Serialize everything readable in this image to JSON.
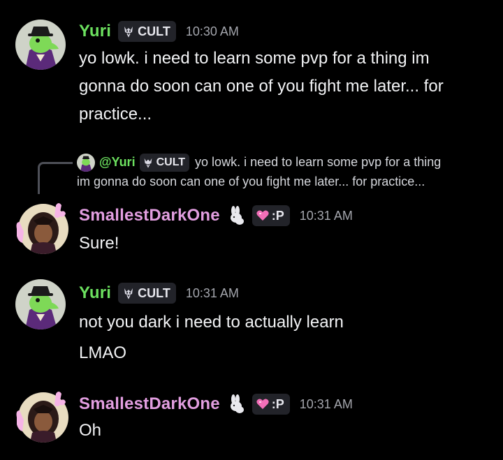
{
  "colors": {
    "background": "#000000",
    "yuri_name": "#6ce05f",
    "dark_name": "#e29ee0",
    "timestamp": "#a4a6ad",
    "tag_bg": "#222329"
  },
  "messages": [
    {
      "author": "Yuri",
      "tag": "CULT",
      "tag_icon": "skull-cult-icon",
      "time": "10:30 AM",
      "lines": [
        "yo lowk. i need to learn some pvp for a thing im",
        "gonna do soon can one of you fight me later... for",
        "practice..."
      ]
    },
    {
      "reply_to": {
        "mention": "@Yuri",
        "tag": "CULT",
        "line1": "yo lowk. i need to learn some pvp for a thing",
        "line2": "im gonna do soon can one of you fight me later... for practice..."
      },
      "author": "SmallestDarkOne",
      "decoration": "rabbit-icon",
      "tag": ":P",
      "tag_icon": "pink-heart-icon",
      "time": "10:31 AM",
      "lines": [
        "Sure!"
      ]
    },
    {
      "author": "Yuri",
      "tag": "CULT",
      "tag_icon": "skull-cult-icon",
      "time": "10:31 AM",
      "lines": [
        "not you dark i need to actually learn",
        "LMAO"
      ]
    },
    {
      "author": "SmallestDarkOne",
      "decoration": "rabbit-icon",
      "tag": ":P",
      "tag_icon": "pink-heart-icon",
      "time": "10:31 AM",
      "lines": [
        "Oh"
      ]
    }
  ]
}
